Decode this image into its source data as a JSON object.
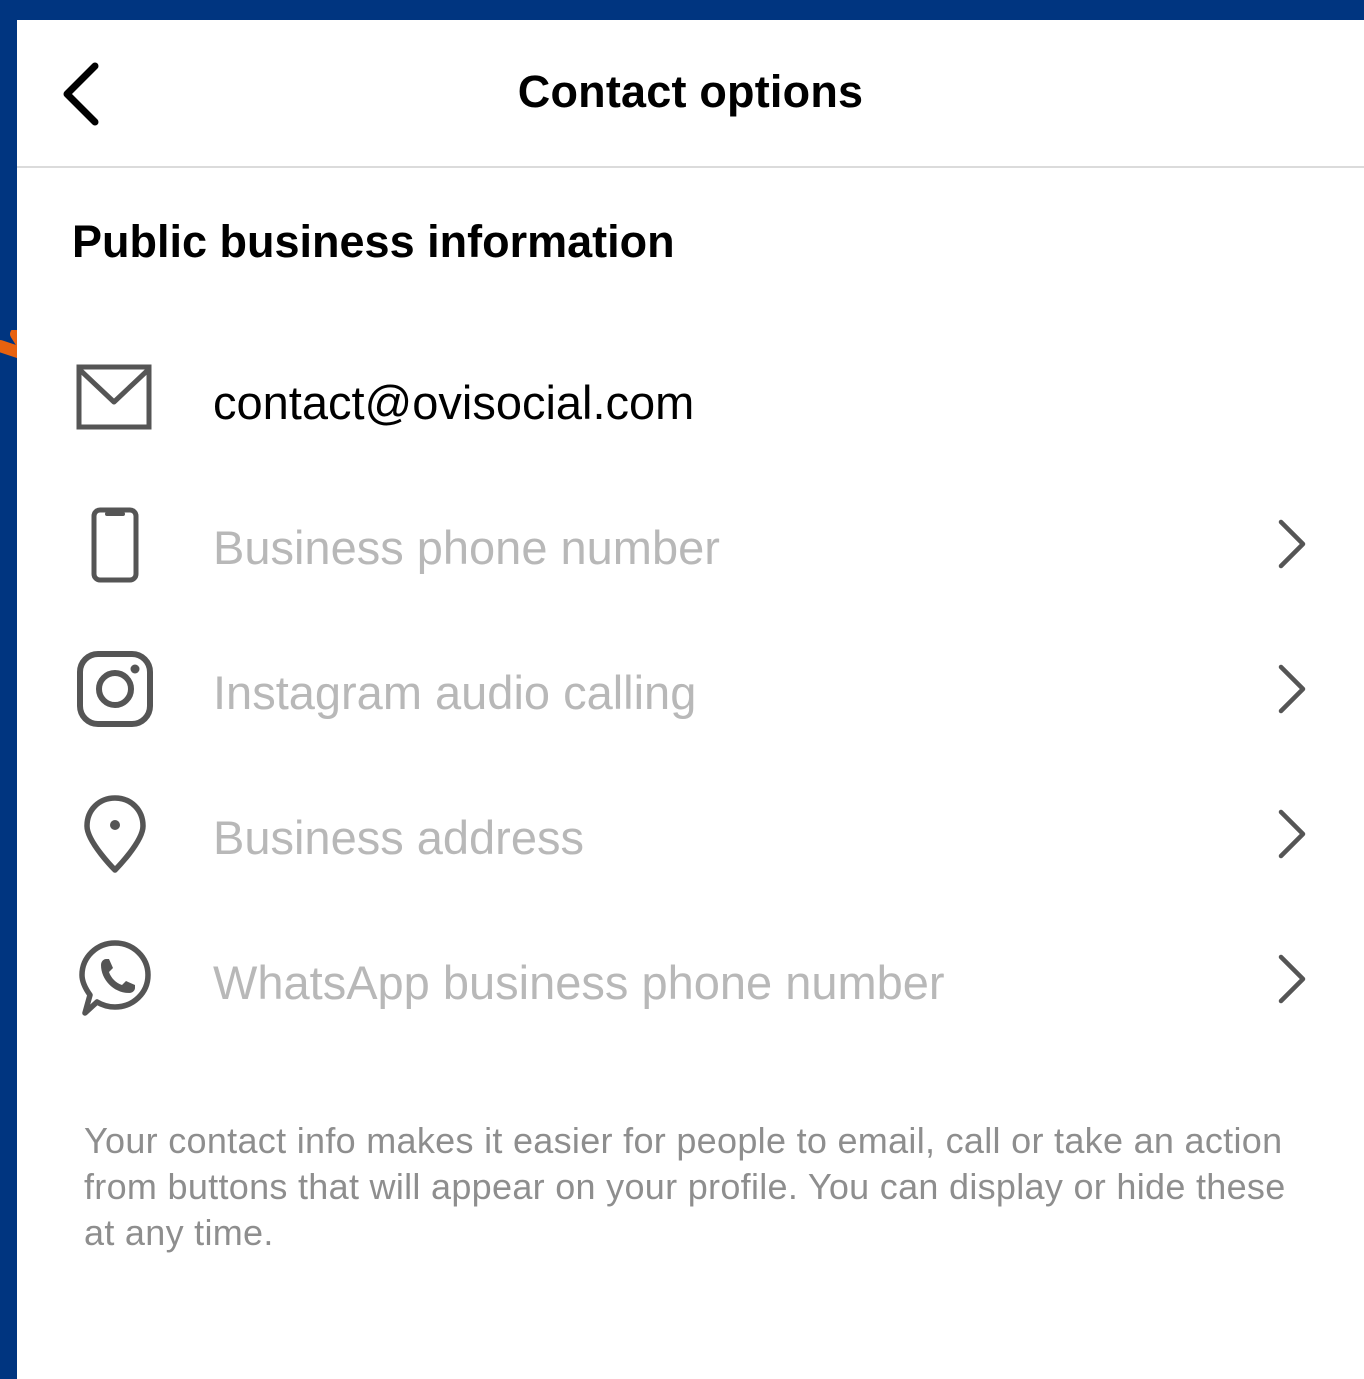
{
  "header": {
    "title": "Contact options"
  },
  "section": {
    "title": "Public business information"
  },
  "rows": [
    {
      "icon": "email-icon",
      "label": "contact@ovisocial.com",
      "filled": true
    },
    {
      "icon": "phone-icon",
      "label": "Business phone number",
      "filled": false
    },
    {
      "icon": "instagram-icon",
      "label": "Instagram audio calling",
      "filled": false
    },
    {
      "icon": "location-pin-icon",
      "label": "Business address",
      "filled": false
    },
    {
      "icon": "whatsapp-icon",
      "label": "WhatsApp business phone number",
      "filled": false
    }
  ],
  "footnote": "Your contact info makes it easier for people to email, call or take an action from buttons that will appear on your profile. You can display or hide these at any time.",
  "colors": {
    "frame": "#003580",
    "annotation_arrow": "#E8620F",
    "placeholder_text": "#b8b8b8",
    "icon_stroke": "#555555"
  }
}
